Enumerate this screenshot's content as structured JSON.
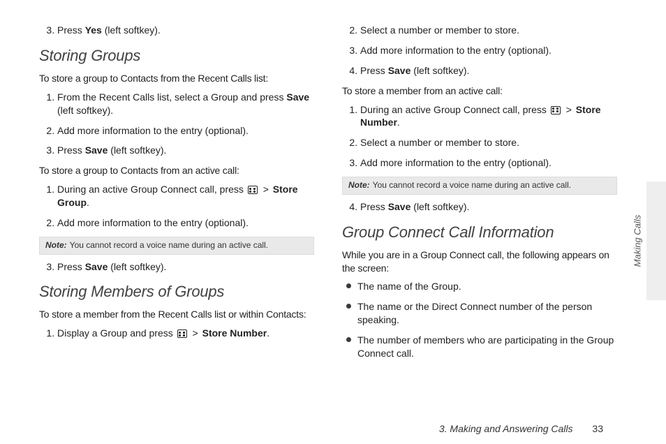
{
  "sideTab": "Making Calls",
  "footer": {
    "section": "3. Making and Answering Calls",
    "page": "33"
  },
  "note": {
    "label": "Note:",
    "text": "You cannot record a voice name during an active call."
  },
  "words": {
    "yes": "Yes",
    "save": "Save",
    "storeGroup": "Store Group",
    "storeNumber": "Store Number",
    "leftSoftkey": " (left softkey).",
    "leftSoftkeyAfter": " (left softkey).",
    "press": "Press ",
    "gt": " > "
  },
  "left": {
    "topStep3_pre": "Press ",
    "h_storingGroups": "Storing Groups",
    "intro1": "To store a group to Contacts from the Recent Calls list:",
    "sg1_step1_pre": "From the Recent Calls list, select a Group and press ",
    "sg1_step2": "Add more information to the entry (optional).",
    "intro2": "To store a group to Contacts from an active call:",
    "sg2_step1_pre": "During an active Group Connect call, press ",
    "sg2_step2": "Add more information to the entry (optional).",
    "h_storingMembers": "Storing Members of Groups",
    "intro3": "To store a member from the Recent Calls list or within Contacts:",
    "sm_step1_pre": "Display a Group and press "
  },
  "right": {
    "r_step2": "Select a number or member to store.",
    "r_step3": "Add more information to the entry (optional).",
    "intro4": "To store a member from an active call:",
    "ac_step1_pre": "During an active Group Connect call, press ",
    "ac_step2": "Select a number or member to store.",
    "ac_step3": "Add more information to the entry (optional).",
    "h_groupConnect": "Group Connect Call Information",
    "gc_intro": "While you are in a Group Connect call, the following appears on the screen:",
    "gc_b1": "The name of the Group.",
    "gc_b2": "The name or the Direct Connect number of the person speaking.",
    "gc_b3": "The number of members who are participating in the Group Connect call."
  }
}
